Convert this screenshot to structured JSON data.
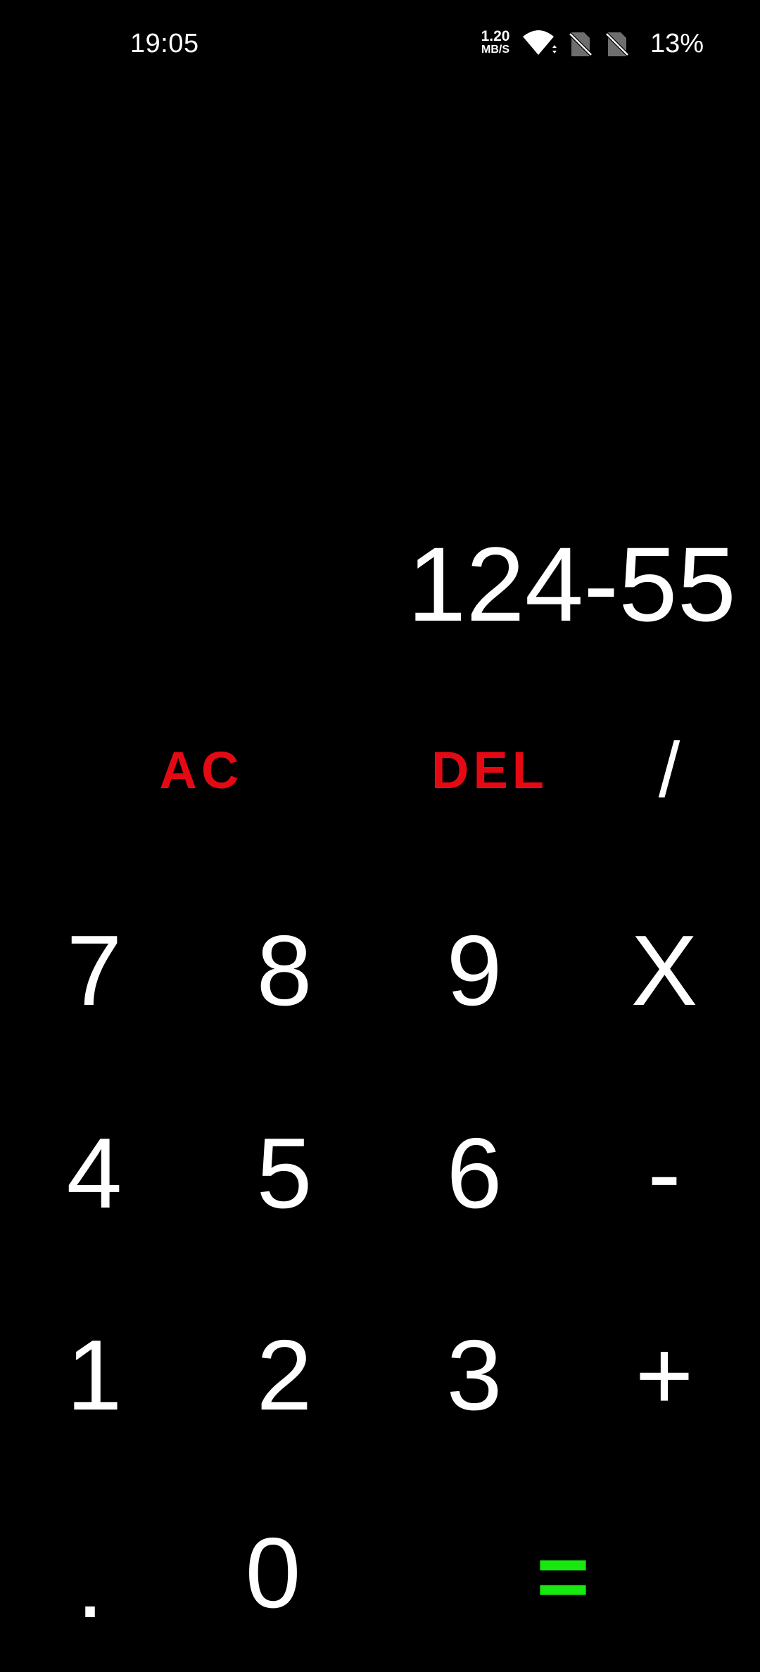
{
  "status_bar": {
    "time": "19:05",
    "net_speed_value": "1.20",
    "net_speed_unit": "MB/S",
    "battery": "13%",
    "icons": [
      "wifi-icon",
      "no-sim-icon",
      "no-sim-icon"
    ]
  },
  "display": {
    "expression": "124-55"
  },
  "keys": {
    "ac": "AC",
    "del": "DEL",
    "divide": "/",
    "seven": "7",
    "eight": "8",
    "nine": "9",
    "multiply": "X",
    "four": "4",
    "five": "5",
    "six": "6",
    "minus": "-",
    "one": "1",
    "two": "2",
    "three": "3",
    "plus": "+",
    "dot": ".",
    "zero": "0",
    "equals": "="
  },
  "colors": {
    "background": "#000000",
    "text": "#ffffff",
    "accent_red": "#e50914",
    "accent_green": "#17e90f"
  }
}
